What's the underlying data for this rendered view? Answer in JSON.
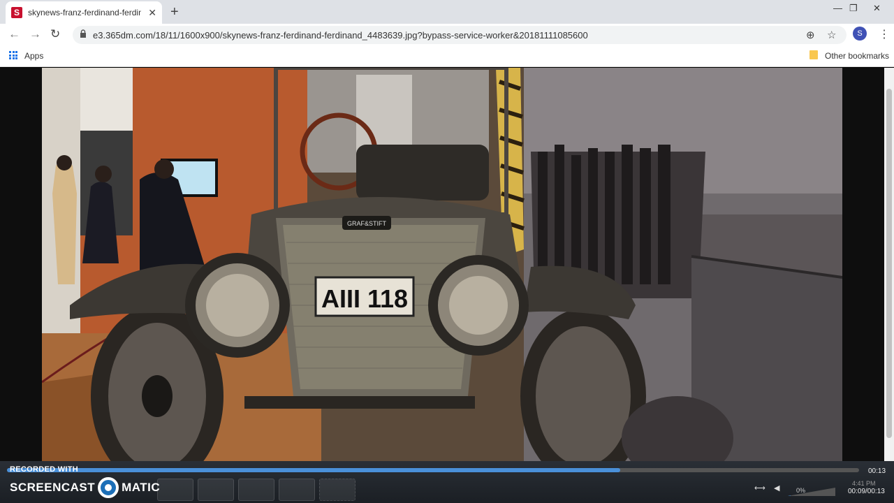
{
  "browser": {
    "tab_title": "skynews-franz-ferdinand-ferdinand",
    "tab_favicon_letter": "S",
    "url": "e3.365dm.com/18/11/1600x900/skynews-franz-ferdinand-ferdinand_4483639.jpg?bypass-service-worker&20181111085600",
    "profile_initial": "S",
    "bookmarks": {
      "apps_label": "Apps",
      "other_label": "Other bookmarks"
    }
  },
  "player": {
    "watermark_small": "RECORDED WITH",
    "watermark_left": "SCREENCAST",
    "watermark_right": "MATIC",
    "time_total": "00:13",
    "duration_readout": "00:09/00:13",
    "volume": "0%",
    "clock": "4:41 PM",
    "progress": 0.72
  },
  "colors": {
    "accent": "#4a90d9",
    "brand": "#c8102e"
  }
}
